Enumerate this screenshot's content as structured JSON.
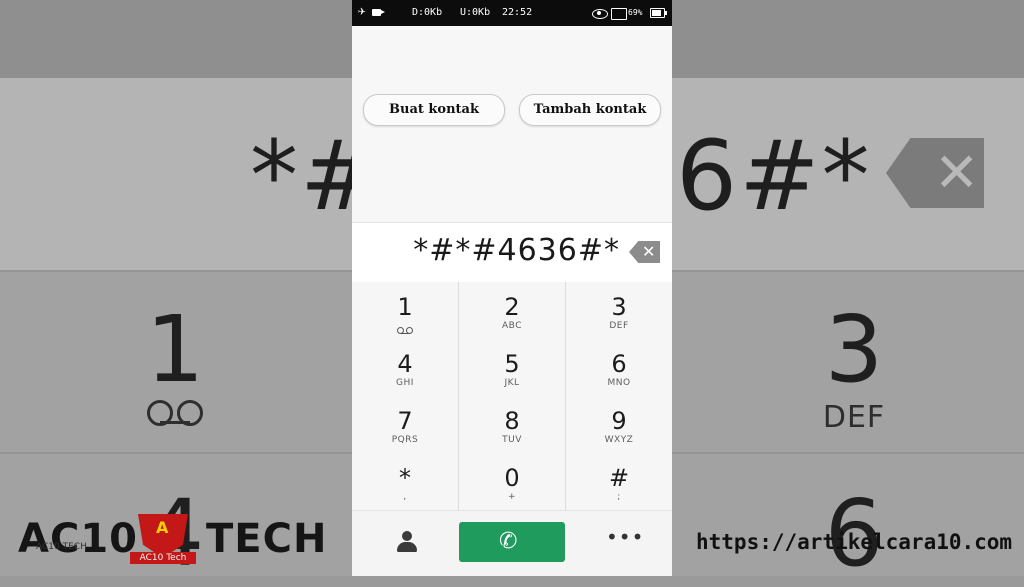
{
  "status_bar": {
    "airplane_icon": "airplane-icon",
    "download": "D:0Kb",
    "upload": "U:0Kb",
    "time": "22:52",
    "battery": "69%"
  },
  "contact_actions": {
    "create_contact": "Buat kontak",
    "add_contact": "Tambah kontak"
  },
  "dialer": {
    "number": "*#*#4636#*",
    "keys": [
      {
        "digit": "1",
        "letters": ""
      },
      {
        "digit": "2",
        "letters": "ABC"
      },
      {
        "digit": "3",
        "letters": "DEF"
      },
      {
        "digit": "4",
        "letters": "GHI"
      },
      {
        "digit": "5",
        "letters": "JKL"
      },
      {
        "digit": "6",
        "letters": "MNO"
      },
      {
        "digit": "7",
        "letters": "PQRS"
      },
      {
        "digit": "8",
        "letters": "TUV"
      },
      {
        "digit": "9",
        "letters": "WXYZ"
      },
      {
        "digit": "*",
        "letters": ","
      },
      {
        "digit": "0",
        "letters": "+"
      },
      {
        "digit": "#",
        "letters": ";"
      }
    ],
    "bottom": {
      "contacts_icon": "person-icon",
      "call_icon": "phone-call-icon",
      "more_icon": "more-dots-icon",
      "more_glyph": "•••"
    },
    "call_color": "#1f9b5e"
  },
  "background": {
    "left_digits": "*#",
    "right_digits": "6#*",
    "big_key_1": "1",
    "big_key_3": "3",
    "big_key_3_letters": "DEF",
    "big_key_4": "4",
    "big_key_6": "6"
  },
  "watermarks": {
    "left_brand_1": "AC10",
    "left_brand_2": "TECH",
    "badge_letter": "A",
    "badge_text": "AC10 Tech",
    "left_small": "AC10 TECH",
    "right_url": "https://artikelcara10.com"
  }
}
